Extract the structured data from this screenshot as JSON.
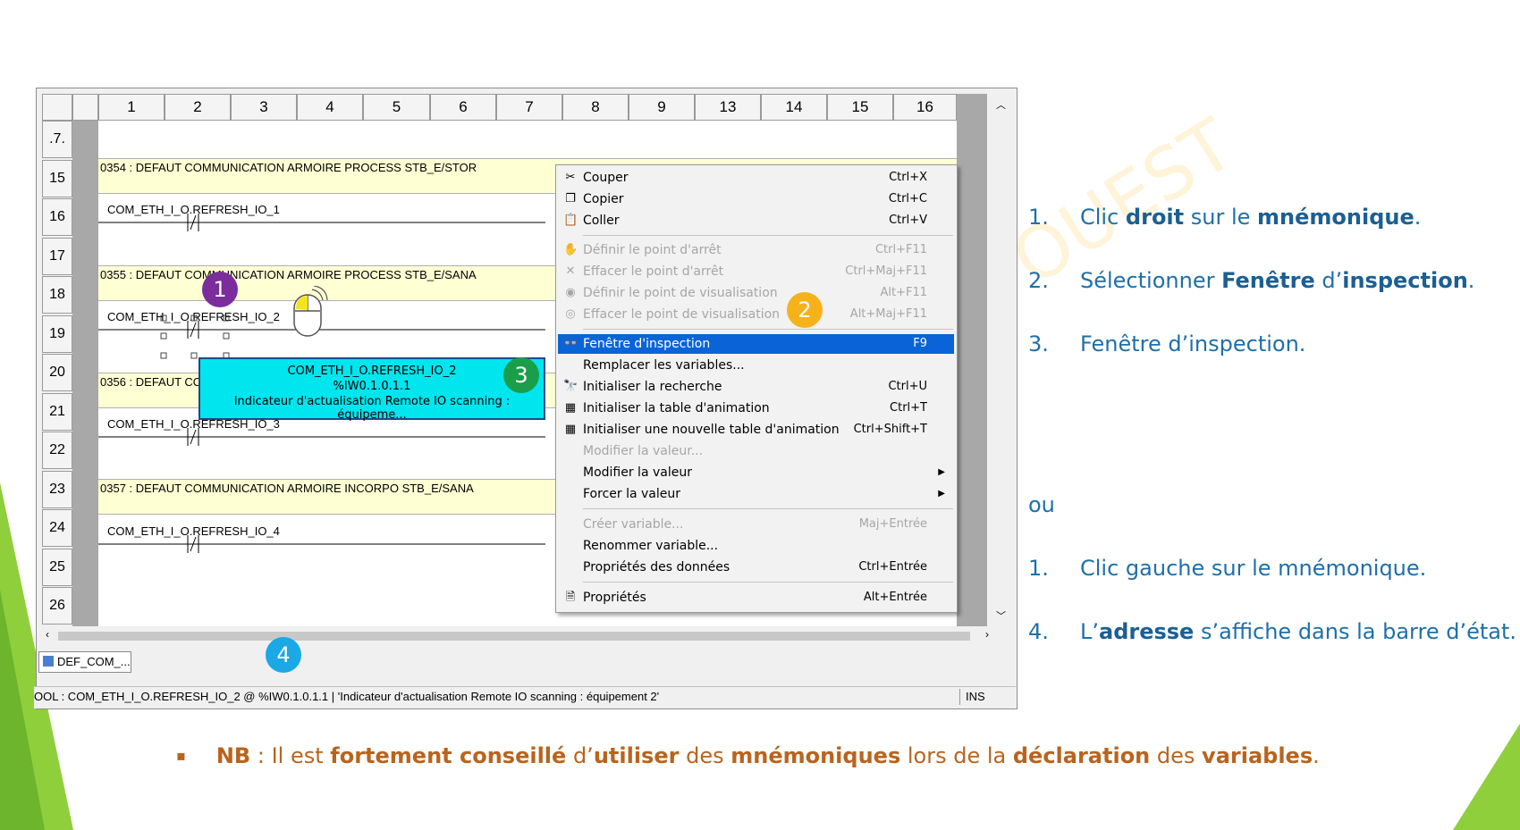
{
  "colors": {
    "accent_green": "#8fcf3c",
    "menu_highlight": "#0a64d8",
    "tooltip_bg": "#00e5ee",
    "step_text": "#1f6fa8",
    "nb_text": "#b9641e"
  },
  "grid": {
    "column_headers": [
      "1",
      "2",
      "3",
      "4",
      "5",
      "6",
      "7",
      "8",
      "9",
      "13",
      "14",
      "15",
      "16"
    ],
    "row_numbers": [
      ".7.",
      "15",
      "16",
      "17",
      "18",
      "19",
      "20",
      "21",
      "22",
      "23",
      "24",
      "25",
      "26"
    ]
  },
  "ladder": {
    "comments": [
      "0354 : DEFAUT COMMUNICATION ARMOIRE PROCESS STB_E/STOR",
      "0355 : DEFAUT COMMUNICATION ARMOIRE PROCESS STB_E/SANA",
      "0356 : DEFAUT CO",
      "0357 : DEFAUT COMMUNICATION ARMOIRE INCORPO STB_E/SANA"
    ],
    "contacts": [
      "COM_ETH_I_O.REFRESH_IO_1",
      "COM_ETH_I_O.REFRESH_IO_2",
      "COM_ETH_I_O.REFRESH_IO_3",
      "COM_ETH_I_O.REFRESH_IO_4"
    ]
  },
  "tooltip": {
    "name": "COM_ETH_I_O.REFRESH_IO_2",
    "address": "%IW0.1.0.1.1",
    "description": "Indicateur d'actualisation Remote IO scanning : équipeme..."
  },
  "context_menu": {
    "items": [
      {
        "label": "Couper",
        "shortcut": "Ctrl+X",
        "icon": "scissors-icon"
      },
      {
        "label": "Copier",
        "shortcut": "Ctrl+C",
        "icon": "copy-icon"
      },
      {
        "label": "Coller",
        "shortcut": "Ctrl+V",
        "icon": "paste-icon"
      },
      {
        "label": "Définir le point d'arrêt",
        "shortcut": "Ctrl+F11",
        "icon": "hand-icon"
      },
      {
        "label": "Effacer le point d'arrêt",
        "shortcut": "Ctrl+Maj+F11",
        "icon": "clear-breakpoint-icon"
      },
      {
        "label": "Définir le point de visualisation",
        "shortcut": "Alt+F11",
        "icon": "watchpoint-icon"
      },
      {
        "label": "Effacer le point de visualisation",
        "shortcut": "Alt+Maj+F11",
        "icon": "clear-watchpoint-icon"
      },
      {
        "label": "Fenêtre d'inspection",
        "shortcut": "F9",
        "icon": "glasses-icon"
      },
      {
        "label": "Remplacer les variables...",
        "shortcut": ""
      },
      {
        "label": "Initialiser la recherche",
        "shortcut": "Ctrl+U",
        "icon": "binoculars-icon"
      },
      {
        "label": "Initialiser la table d'animation",
        "shortcut": "Ctrl+T",
        "icon": "animation-table-icon"
      },
      {
        "label": "Initialiser une nouvelle table d'animation",
        "shortcut": "Ctrl+Shift+T",
        "icon": "new-animation-table-icon"
      },
      {
        "label": "Modifier la valeur...",
        "shortcut": ""
      },
      {
        "label": "Modifier la valeur",
        "shortcut": ""
      },
      {
        "label": "Forcer la valeur",
        "shortcut": ""
      },
      {
        "label": "Créer variable...",
        "shortcut": "Maj+Entrée"
      },
      {
        "label": "Renommer variable...",
        "shortcut": ""
      },
      {
        "label": "Propriétés des données",
        "shortcut": "Ctrl+Entrée"
      },
      {
        "label": "Propriétés",
        "shortcut": "Alt+Entrée",
        "icon": "properties-icon"
      }
    ]
  },
  "tab": {
    "label": "DEF_COM_..."
  },
  "status_bar": {
    "text": "OOL : COM_ETH_I_O.REFRESH_IO_2 @ %IW0.1.0.1.1 | 'Indicateur d'actualisation Remote IO scanning : équipement 2'",
    "mode": "INS"
  },
  "badges": [
    "1",
    "2",
    "3",
    "4"
  ],
  "steps": {
    "s1": {
      "num": "1.",
      "a": "Clic ",
      "b": "droit",
      "c": " sur le ",
      "d": "mnémonique",
      "e": "."
    },
    "s2": {
      "num": "2.",
      "a": "Sélectionner ",
      "b": "Fenêtre",
      "c": " d’",
      "d": "inspection",
      "e": "."
    },
    "s3": {
      "num": "3.",
      "text": "Fenêtre d’inspection."
    },
    "ou": "ou",
    "s4": {
      "num": "1.",
      "text": "Clic gauche sur le mnémonique."
    },
    "s5": {
      "num": "4.",
      "a": "L’",
      "b": "adresse",
      "c": " s’affiche dans la barre d’état."
    }
  },
  "nb": {
    "bullet": "▪",
    "p1": "NB",
    "p2": " : Il est ",
    "p3": "fortement conseillé",
    "p4": " d’",
    "p5": "utiliser",
    "p6": " des ",
    "p7": "mnémoniques",
    "p8": " lors de la ",
    "p9": "déclaration",
    "p10": " des ",
    "p11": "variables",
    "p12": "."
  },
  "watermark": "OUEST"
}
